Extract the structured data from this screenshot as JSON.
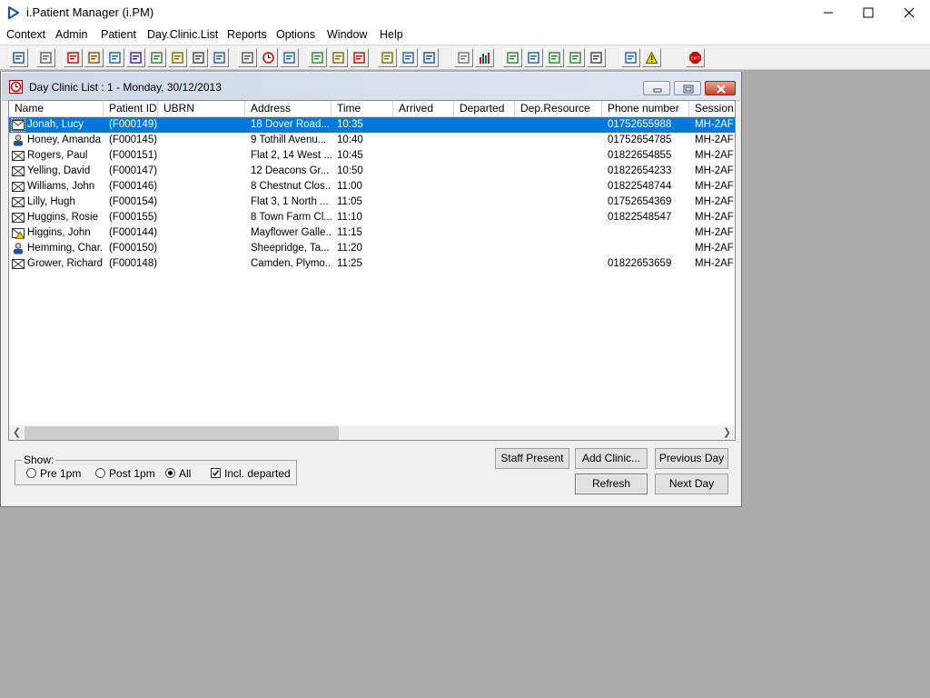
{
  "app": {
    "title": "i.Patient Manager (i.PM)"
  },
  "menu": [
    "Context",
    "Admin",
    "Patient",
    "Day.Clinic.List",
    "Reports",
    "Options",
    "Window",
    "Help"
  ],
  "toolbar_icons": [
    "patient-icon",
    "printer-icon",
    "book-icon",
    "edit-book-icon",
    "image-icon",
    "letter-m-icon",
    "person-card-icon",
    "notes-icon",
    "camera-icon",
    "photo-icon",
    "envelope-cross-icon",
    "clock-icon",
    "monitor-icon",
    "picture-icon",
    "note-icon",
    "clock-note-icon",
    "memo-icon",
    "bed-icon",
    "nurse-icon",
    "document-icon",
    "bar-chart-icon",
    "globe-icon",
    "check-form-icon",
    "check-arrow-icon",
    "arrow-down-icon",
    "swap-icon",
    "swap-arrows-icon",
    "warning-icon",
    "exit-icon"
  ],
  "clinic": {
    "title": "Day Clinic List : 1 - Monday, 30/12/2013",
    "columns": [
      "Name",
      "Patient ID",
      "UBRN",
      "Address",
      "Time",
      "Arrived",
      "Departed",
      "Dep.Resource",
      "Phone number",
      "Session C"
    ],
    "rows": [
      {
        "name": "Jonah, Lucy",
        "id": "(F000149)",
        "ubrn": "",
        "address": "18 Dover Road...",
        "time": "10:35",
        "arrived": "",
        "departed": "",
        "dep": "",
        "phone": "01752655988",
        "session": "MH-2AF",
        "icon": "envelope-icon"
      },
      {
        "name": "Honey, Amanda",
        "id": "(F000145)",
        "ubrn": "",
        "address": "9 Tothill Avenu...",
        "time": "10:40",
        "arrived": "",
        "departed": "",
        "dep": "",
        "phone": "01752654785",
        "session": "MH-2AF",
        "icon": "person-icon"
      },
      {
        "name": "Rogers, Paul",
        "id": "(F000151)",
        "ubrn": "",
        "address": "Flat 2, 14 West ...",
        "time": "10:45",
        "arrived": "",
        "departed": "",
        "dep": "",
        "phone": "01822654855",
        "session": "MH-2AF",
        "icon": "envelope-cross-icon"
      },
      {
        "name": "Yelling, David",
        "id": "(F000147)",
        "ubrn": "",
        "address": "12 Deacons Gr...",
        "time": "10:50",
        "arrived": "",
        "departed": "",
        "dep": "",
        "phone": "01822654233",
        "session": "MH-2AF",
        "icon": "envelope-cross-icon"
      },
      {
        "name": "Williams, John",
        "id": "(F000146)",
        "ubrn": "",
        "address": "8 Chestnut Clos...",
        "time": "11:00",
        "arrived": "",
        "departed": "",
        "dep": "",
        "phone": "01822548744",
        "session": "MH-2AF",
        "icon": "envelope-cross-icon"
      },
      {
        "name": "Lilly, Hugh",
        "id": "(F000154)",
        "ubrn": "",
        "address": "Flat 3, 1 North ...",
        "time": "11:05",
        "arrived": "",
        "departed": "",
        "dep": "",
        "phone": "01752654369",
        "session": "MH-2AF",
        "icon": "envelope-cross-icon"
      },
      {
        "name": "Huggins, Rosie",
        "id": "(F000155)",
        "ubrn": "",
        "address": "8 Town Farm Cl...",
        "time": "11:10",
        "arrived": "",
        "departed": "",
        "dep": "",
        "phone": "01822548547",
        "session": "MH-2AF",
        "icon": "envelope-cross-icon"
      },
      {
        "name": "Higgins, John",
        "id": "(F000144)",
        "ubrn": "",
        "address": "Mayflower Galle...",
        "time": "11:15",
        "arrived": "",
        "departed": "",
        "dep": "",
        "phone": "",
        "session": "MH-2AF",
        "icon": "warning-envelope-icon"
      },
      {
        "name": "Hemming, Char...",
        "id": "(F000150)",
        "ubrn": "",
        "address": "Sheepridge, Ta...",
        "time": "11:20",
        "arrived": "",
        "departed": "",
        "dep": "",
        "phone": "",
        "session": "MH-2AF",
        "icon": "person-icon"
      },
      {
        "name": "Grower, Richard",
        "id": "(F000148)",
        "ubrn": "",
        "address": "Camden, Plymo...",
        "time": "11:25",
        "arrived": "",
        "departed": "",
        "dep": "",
        "phone": "01822653659",
        "session": "MH-2AF",
        "icon": "envelope-cross-icon"
      }
    ],
    "selected_row": 0
  },
  "show": {
    "legend": "Show:",
    "options": [
      "Pre 1pm",
      "Post 1pm",
      "All"
    ],
    "selected": "All",
    "incl_departed_label": "Incl. departed",
    "incl_departed": true
  },
  "buttons": {
    "staff_present": "Staff Present",
    "add_clinic": "Add Clinic...",
    "previous_day": "Previous Day",
    "refresh": "Refresh",
    "next_day": "Next Day"
  },
  "colors": {
    "selection": "#0078d7",
    "mdi_background": "#ababab"
  }
}
